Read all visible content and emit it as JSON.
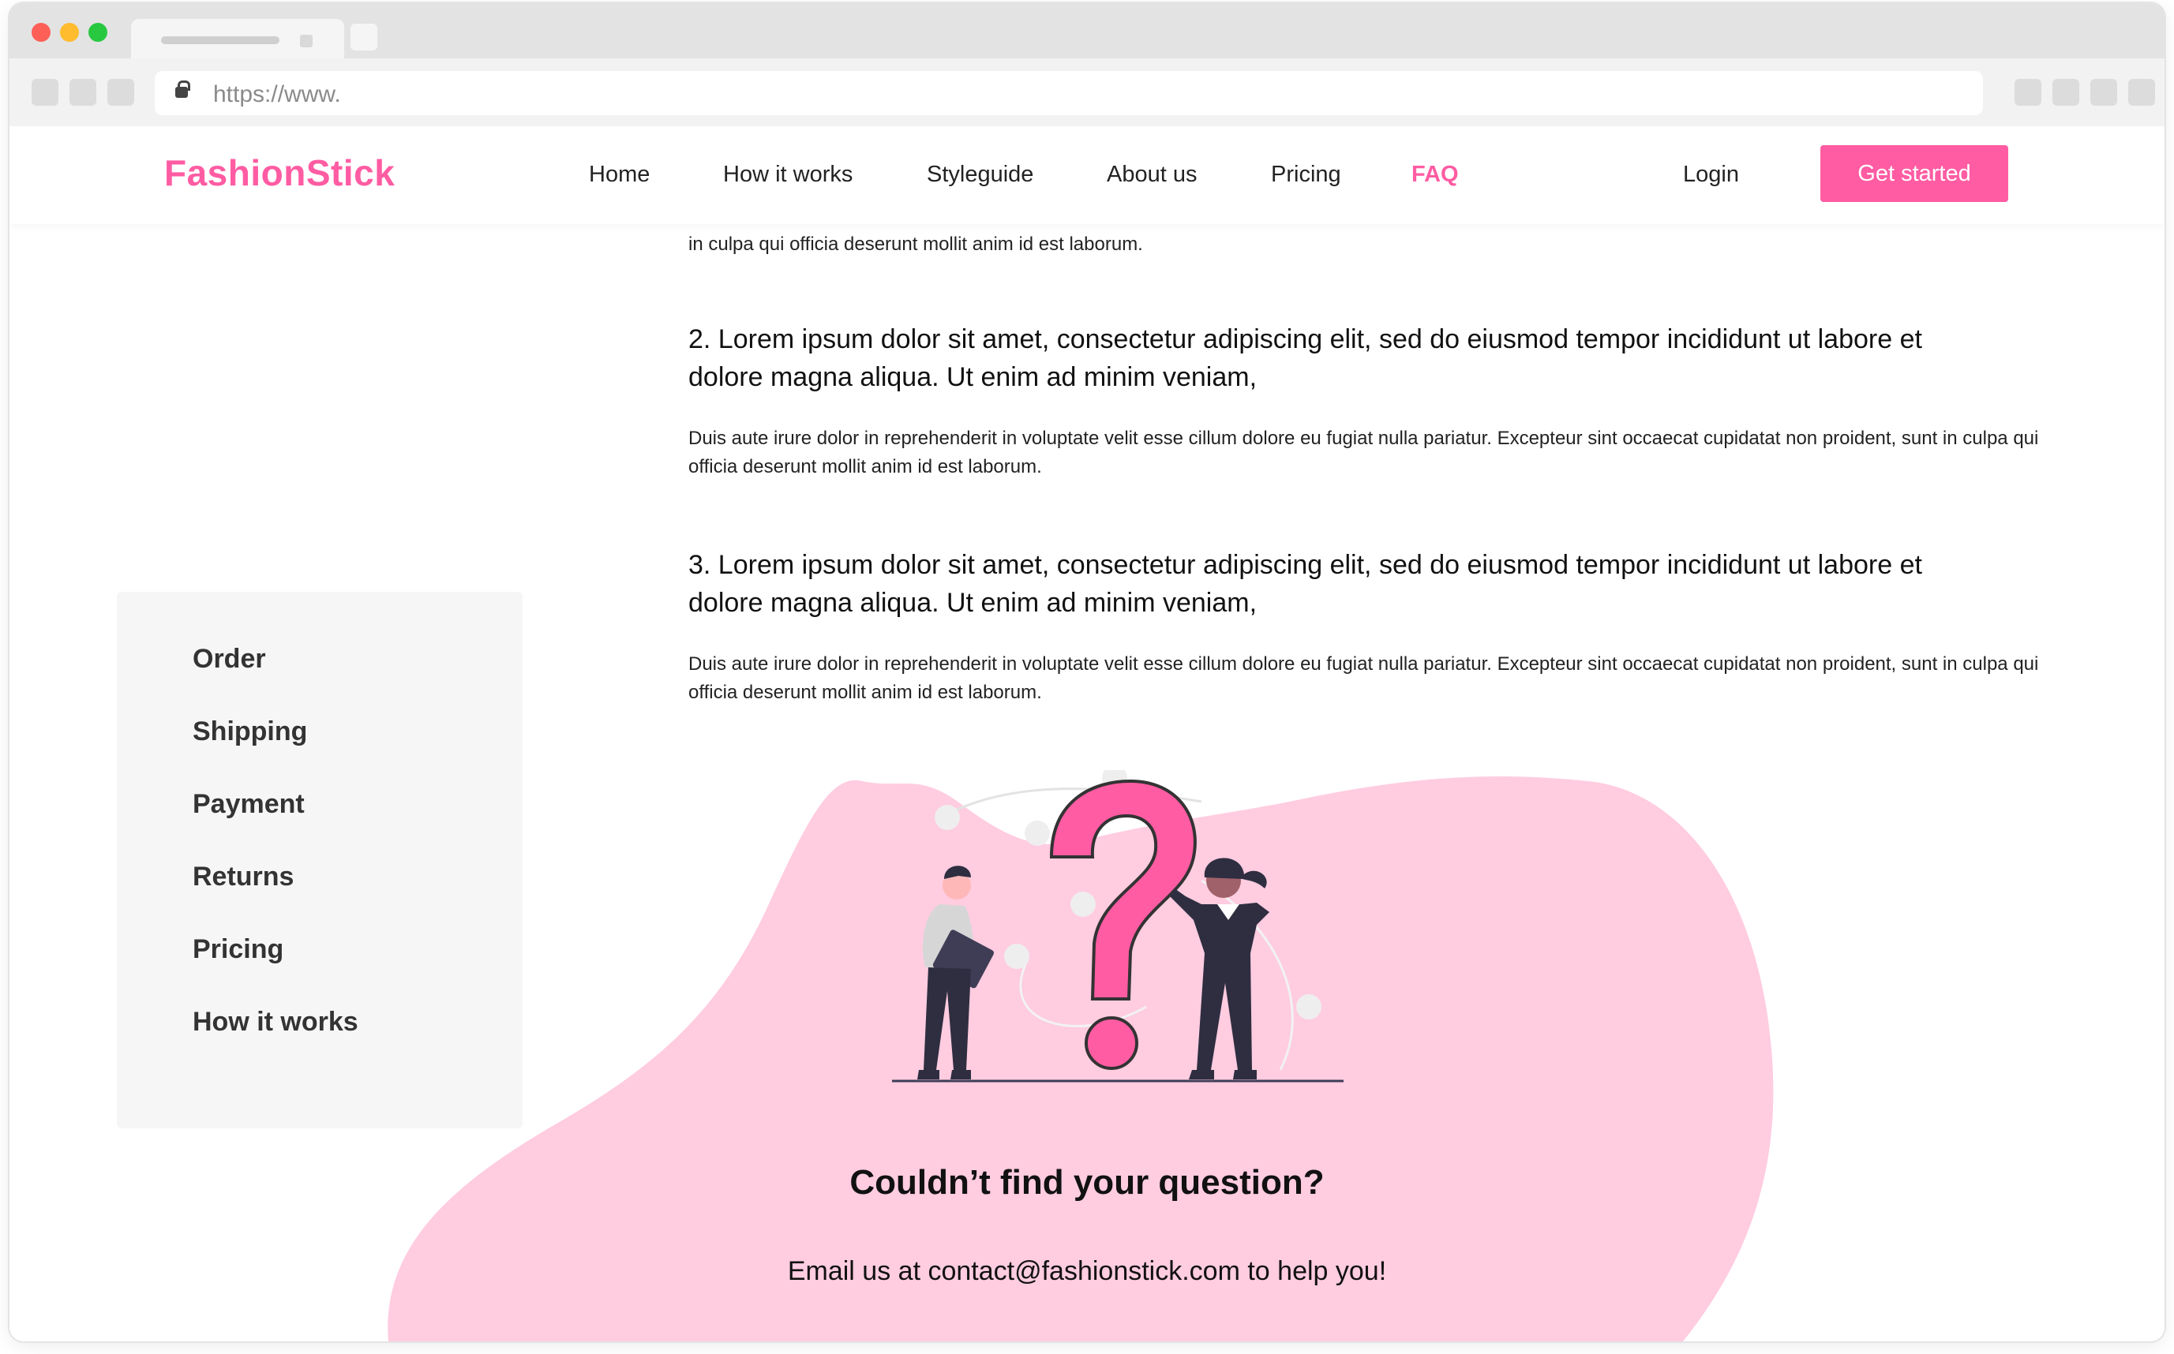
{
  "browser": {
    "url": "https://www."
  },
  "header": {
    "logo": "FashionStick",
    "nav": [
      "Home",
      "How it works",
      "Styleguide",
      "About us",
      "Pricing",
      "FAQ"
    ],
    "active_nav": "FAQ",
    "login": "Login",
    "cta": "Get started"
  },
  "faq": {
    "cut_answer": "in culpa qui officia deserunt mollit anim id est laborum.",
    "items": [
      {
        "question": "2. Lorem ipsum dolor sit amet, consectetur adipiscing elit, sed do eiusmod tempor incididunt ut labore et dolore magna aliqua. Ut enim ad minim veniam,",
        "answer": "Duis aute irure dolor in reprehenderit in voluptate velit esse cillum dolore eu fugiat nulla pariatur. Excepteur sint occaecat cupidatat non proident, sunt in culpa qui officia deserunt mollit anim id est laborum."
      },
      {
        "question": "3. Lorem ipsum dolor sit amet, consectetur adipiscing elit, sed do eiusmod tempor incididunt ut labore et dolore magna aliqua. Ut enim ad minim veniam,",
        "answer": "Duis aute irure dolor in reprehenderit in voluptate velit esse cillum dolore eu fugiat nulla pariatur. Excepteur sint occaecat cupidatat non proident, sunt in culpa qui officia deserunt mollit anim id est laborum."
      }
    ]
  },
  "sidebar": {
    "items": [
      "Order",
      "Shipping",
      "Payment",
      "Returns",
      "Pricing",
      "How it works"
    ]
  },
  "contact": {
    "title": "Couldn’t find your question?",
    "text": "Email us at contact@fashionstick.com to help you!"
  },
  "colors": {
    "brand": "#ff5ca3",
    "blob": "#ffcce0",
    "sidebar_bg": "#f6f6f6"
  },
  "icons": [
    "lock-icon",
    "question-illustration"
  ]
}
